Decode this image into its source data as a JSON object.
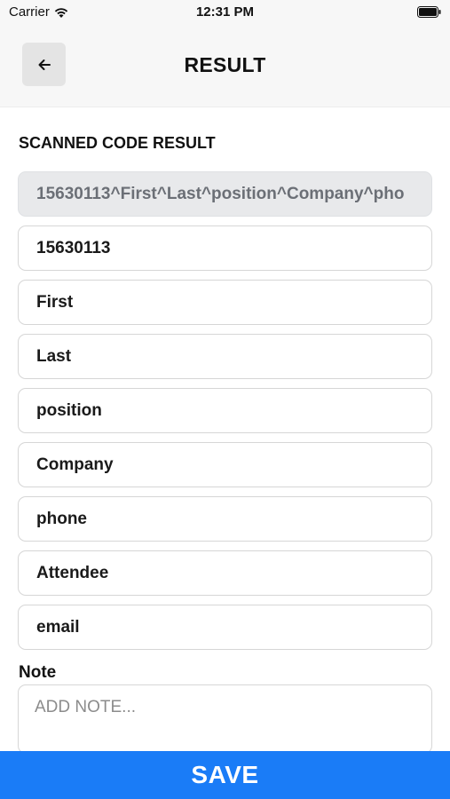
{
  "status_bar": {
    "carrier": "Carrier",
    "time": "12:31 PM"
  },
  "header": {
    "title": "RESULT",
    "back_icon": "arrow-left-icon"
  },
  "section": {
    "title": "SCANNED CODE RESULT"
  },
  "raw_scan": "15630113^First^Last^position^Company^pho",
  "fields": [
    "15630113",
    "First",
    "Last",
    "position",
    "Company",
    "phone",
    "Attendee",
    "email"
  ],
  "note": {
    "label": "Note",
    "placeholder": "ADD NOTE..."
  },
  "save_label": "SAVE",
  "colors": {
    "accent": "#1a7cf7",
    "header_bg": "#f7f7f7",
    "raw_field_bg": "#e8e9eb"
  }
}
